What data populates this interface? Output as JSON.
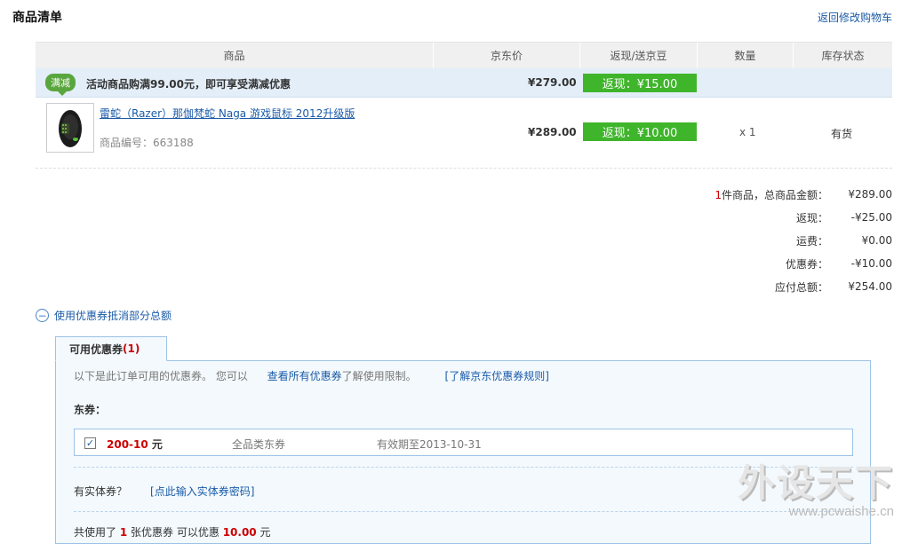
{
  "header": {
    "title": "商品清单",
    "back_link": "返回修改购物车"
  },
  "table": {
    "columns": [
      "商品",
      "京东价",
      "返现/送京豆",
      "数量",
      "库存状态"
    ],
    "promo": {
      "badge": "满减",
      "text": "活动商品购满99.00元，即可享受满减优惠",
      "price": "¥279.00",
      "cashback": "返现：¥15.00"
    },
    "item": {
      "name": "雷蛇（Razer）那伽梵蛇 Naga 游戏鼠标 2012升级版",
      "code": "商品编号：663188",
      "price": "¥289.00",
      "cashback": "返现：¥10.00",
      "qty": "x 1",
      "stock": "有货"
    }
  },
  "summary": {
    "count": "1",
    "count_suffix": "件商品，总商品金额：",
    "total": "¥289.00",
    "cashback_label": "返现：",
    "cashback": "-¥25.00",
    "shipping_label": "运费：",
    "shipping": "¥0.00",
    "coupon_label": "优惠券：",
    "coupon": "-¥10.00",
    "payable_label": "应付总额：",
    "payable": "¥254.00"
  },
  "coupon": {
    "toggle_label": "使用优惠券抵消部分总额",
    "tab_label": "可用优惠券",
    "tab_count": "(1)",
    "intro_text": "以下是此订单可用的优惠券。 您可以",
    "view_all_link": "查看所有优惠券",
    "intro_suffix": "了解使用限制。",
    "rules_link": "[了解京东优惠券规则]",
    "section_label": "东券：",
    "item": {
      "amount": "200-10",
      "unit": "元",
      "type": "全品类东券",
      "expiry": "有效期至2013-10-31"
    },
    "physical_label": "有实体券？",
    "physical_link": "[点此输入实体券密码]",
    "used_prefix": "共使用了",
    "used_count": "1",
    "used_mid": "张优惠券  可以优惠",
    "used_amount": "10.00",
    "used_suffix": "元"
  },
  "watermark": {
    "main": "外设天下",
    "url": "www.pcwaishe.cn"
  },
  "colors": {
    "link": "#1a5ba8",
    "cashback_green": "#3fb52b",
    "highlight_red": "#cc0000",
    "promo_bg": "#e3eef8"
  }
}
